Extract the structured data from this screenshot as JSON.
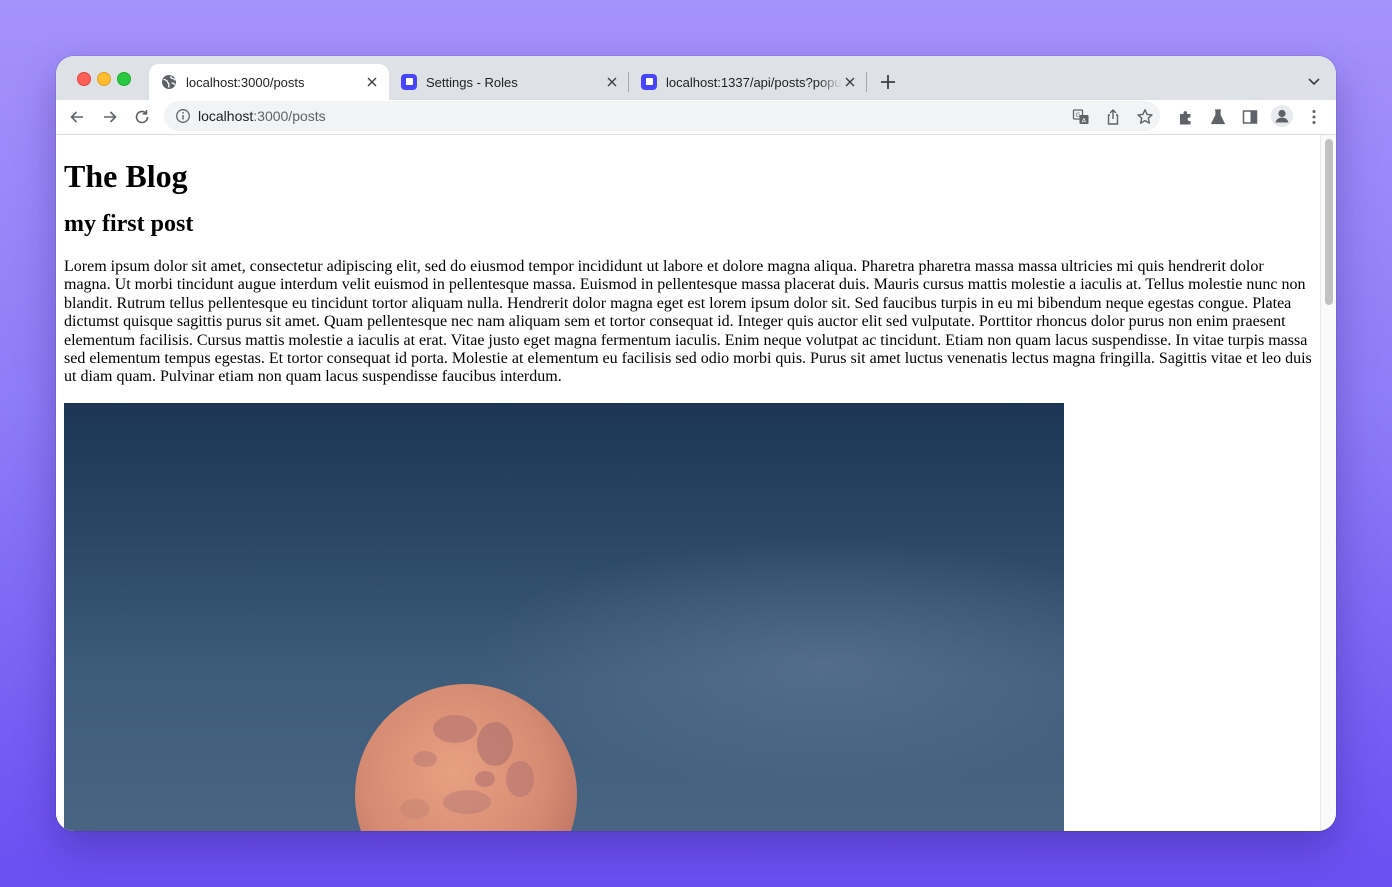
{
  "browser": {
    "tabs": [
      {
        "title": "localhost:3000/posts",
        "active": true,
        "favicon": "globe-icon"
      },
      {
        "title": "Settings - Roles",
        "active": false,
        "favicon": "strapi-icon"
      },
      {
        "title": "localhost:1337/api/posts?popu",
        "active": false,
        "favicon": "strapi-icon"
      }
    ],
    "address": {
      "host": "localhost",
      "path": ":3000/posts"
    },
    "icons": [
      "back-arrow-icon",
      "forward-arrow-icon",
      "reload-icon",
      "info-icon",
      "translate-icon",
      "share-icon",
      "star-icon",
      "extensions-icon",
      "labs-flask-icon",
      "side-panel-icon",
      "profile-icon",
      "more-icon"
    ],
    "colors": {
      "accent": "#4945ff",
      "tab_strip": "#dee1e6"
    }
  },
  "page": {
    "title": "The Blog",
    "posts": [
      {
        "title": "my first post",
        "body": "Lorem ipsum dolor sit amet, consectetur adipiscing elit, sed do eiusmod tempor incididunt ut labore et dolore magna aliqua. Pharetra pharetra massa massa ultricies mi quis hendrerit dolor magna. Ut morbi tincidunt augue interdum velit euismod in pellentesque massa. Euismod in pellentesque massa placerat duis. Mauris cursus mattis molestie a iaculis at. Tellus molestie nunc non blandit. Rutrum tellus pellentesque eu tincidunt tortor aliquam nulla. Hendrerit dolor magna eget est lorem ipsum dolor sit. Sed faucibus turpis in eu mi bibendum neque egestas congue. Platea dictumst quisque sagittis purus sit amet. Quam pellentesque nec nam aliquam sem et tortor consequat id. Integer quis auctor elit sed vulputate. Porttitor rhoncus dolor purus non enim praesent elementum facilisis. Cursus mattis molestie a iaculis at erat. Vitae justo eget magna fermentum iaculis. Enim neque volutpat ac tincidunt. Etiam non quam lacus suspendisse. In vitae turpis massa sed elementum tempus egestas. Et tortor consequat id porta. Molestie at elementum eu facilisis sed odio morbi quis. Purus sit amet luctus venenatis lectus magna fringilla. Sagittis vitae et leo duis ut diam quam. Pulvinar etiam non quam lacus suspendisse faucibus interdum."
      }
    ]
  }
}
